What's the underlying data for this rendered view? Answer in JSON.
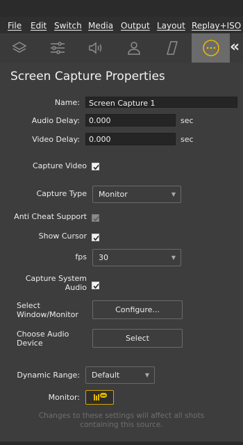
{
  "menu": [
    {
      "label": "File"
    },
    {
      "label": "Edit"
    },
    {
      "label": "Switch"
    },
    {
      "label": "Media"
    },
    {
      "label": "Output"
    },
    {
      "label": "Layout"
    },
    {
      "label": "Replay+ISO"
    }
  ],
  "toolbar_icons": [
    "layers-icon",
    "sliders-icon",
    "speaker-icon",
    "person-icon",
    "parallelogram-icon",
    "more-options-icon"
  ],
  "collapse_glyph": "«",
  "accent_color": "#e8b800",
  "panel": {
    "title": "Screen Capture Properties",
    "name_label": "Name:",
    "name_value": "Screen Capture 1",
    "audio_delay_label": "Audio Delay:",
    "audio_delay_value": "0.000",
    "audio_delay_unit": "sec",
    "video_delay_label": "Video Delay:",
    "video_delay_value": "0.000",
    "video_delay_unit": "sec",
    "capture_video_label": "Capture Video",
    "capture_video_checked": true,
    "capture_type_label": "Capture Type",
    "capture_type_value": "Monitor",
    "anti_cheat_label": "Anti Cheat Support",
    "anti_cheat_checked": true,
    "show_cursor_label": "Show Cursor",
    "show_cursor_checked": true,
    "fps_label": "fps",
    "fps_value": "30",
    "capture_audio_label_1": "Capture System",
    "capture_audio_label_2": "Audio",
    "capture_audio_checked": true,
    "select_window_label_1": "Select",
    "select_window_label_2": "Window/Monitor",
    "configure_button": "Configure...",
    "choose_audio_label_1": "Choose Audio",
    "choose_audio_label_2": "Device",
    "select_button": "Select",
    "dynamic_range_label": "Dynamic Range:",
    "dynamic_range_value": "Default",
    "monitor_label": "Monitor:",
    "note_line_1": "Changes to these settings will affect all shots",
    "note_line_2": "containing this source."
  }
}
